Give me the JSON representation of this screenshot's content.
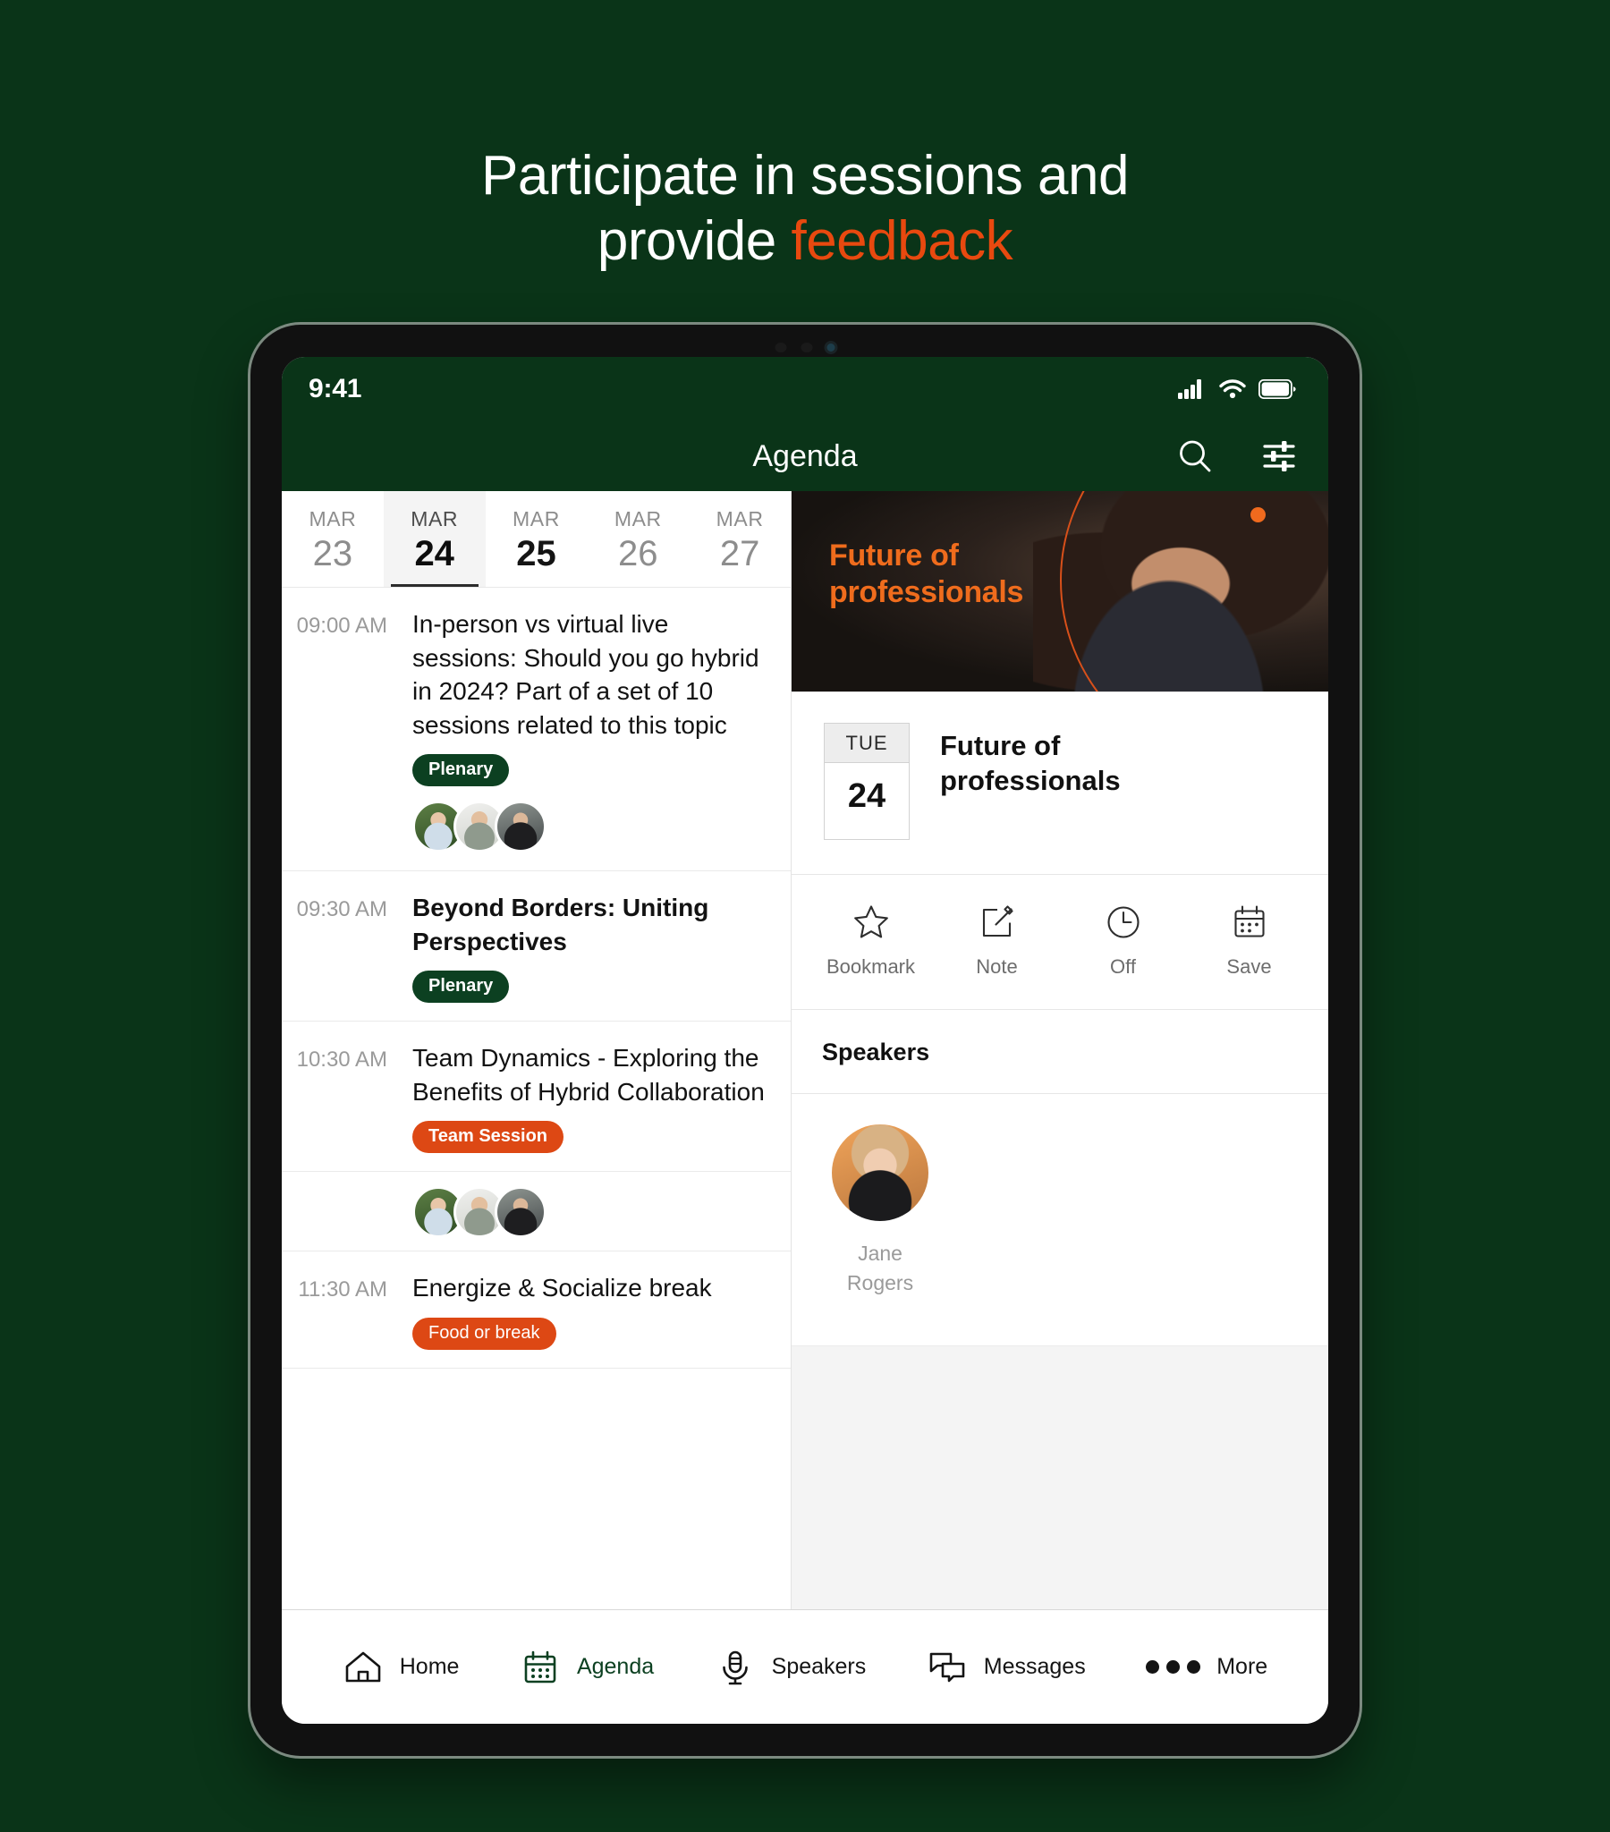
{
  "promo": {
    "line1": "Participate in sessions and",
    "line2_prefix": "provide ",
    "line2_accent": "feedback",
    "accent_color": "#e8490f",
    "background_color": "#0a3418"
  },
  "status_bar": {
    "time": "9:41",
    "icons": [
      "signal-icon",
      "wifi-icon",
      "battery-icon"
    ]
  },
  "nav_bar": {
    "title": "Agenda",
    "search_icon": "search-icon",
    "filter_icon": "filter-sliders-icon"
  },
  "date_strip": {
    "days": [
      {
        "month": "MAR",
        "day": "23",
        "state": "inactive"
      },
      {
        "month": "MAR",
        "day": "24",
        "state": "selected"
      },
      {
        "month": "MAR",
        "day": "25",
        "state": "bold"
      },
      {
        "month": "MAR",
        "day": "26",
        "state": "inactive"
      },
      {
        "month": "MAR",
        "day": "27",
        "state": "inactive"
      }
    ]
  },
  "sessions": [
    {
      "time": "09:00 AM",
      "title": "In-person vs virtual live sessions: Should you go hybrid in 2024? Part of a set of 10 sessions related to this topic",
      "bold": false,
      "badge": {
        "label": "Plenary",
        "color": "#0c4021",
        "style": "green"
      },
      "avatars": 3
    },
    {
      "time": "09:30 AM",
      "title": "Beyond Borders: Uniting Perspectives",
      "bold": true,
      "badge": {
        "label": "Plenary",
        "color": "#0c4021",
        "style": "green"
      },
      "avatars": 0
    },
    {
      "time": "10:30 AM",
      "title": "Team Dynamics - Exploring the Benefits of Hybrid Collaboration",
      "bold": false,
      "badge": {
        "label": "Team Session",
        "color": "#dd4814",
        "style": "orange"
      },
      "avatars": 3
    },
    {
      "time": "11:30 AM",
      "title": "Energize & Socialize break",
      "bold": false,
      "badge": {
        "label": "Food or break",
        "color": "#dd4814",
        "style": "orange-light"
      },
      "avatars": 0
    }
  ],
  "detail": {
    "hero": {
      "title_line1": "Future of",
      "title_line2": "professionals",
      "text_color": "#ef6c1d"
    },
    "date_card": {
      "weekday": "TUE",
      "day": "24"
    },
    "title_line1": "Future of",
    "title_line2": "professionals",
    "actions": [
      {
        "label": "Bookmark",
        "icon": "star-icon"
      },
      {
        "label": "Note",
        "icon": "note-pencil-icon"
      },
      {
        "label": "Off",
        "icon": "clock-icon"
      },
      {
        "label": "Save",
        "icon": "calendar-icon"
      }
    ],
    "speakers_heading": "Speakers",
    "speakers": [
      {
        "first_name": "Jane",
        "last_name": "Rogers"
      }
    ]
  },
  "tab_bar": {
    "items": [
      {
        "label": "Home",
        "icon": "home-icon",
        "active": false
      },
      {
        "label": "Agenda",
        "icon": "calendar-icon",
        "active": true
      },
      {
        "label": "Speakers",
        "icon": "microphone-icon",
        "active": false
      },
      {
        "label": "Messages",
        "icon": "chat-bubbles-icon",
        "active": false
      },
      {
        "label": "More",
        "icon": "ellipsis-icon",
        "active": false
      }
    ]
  }
}
